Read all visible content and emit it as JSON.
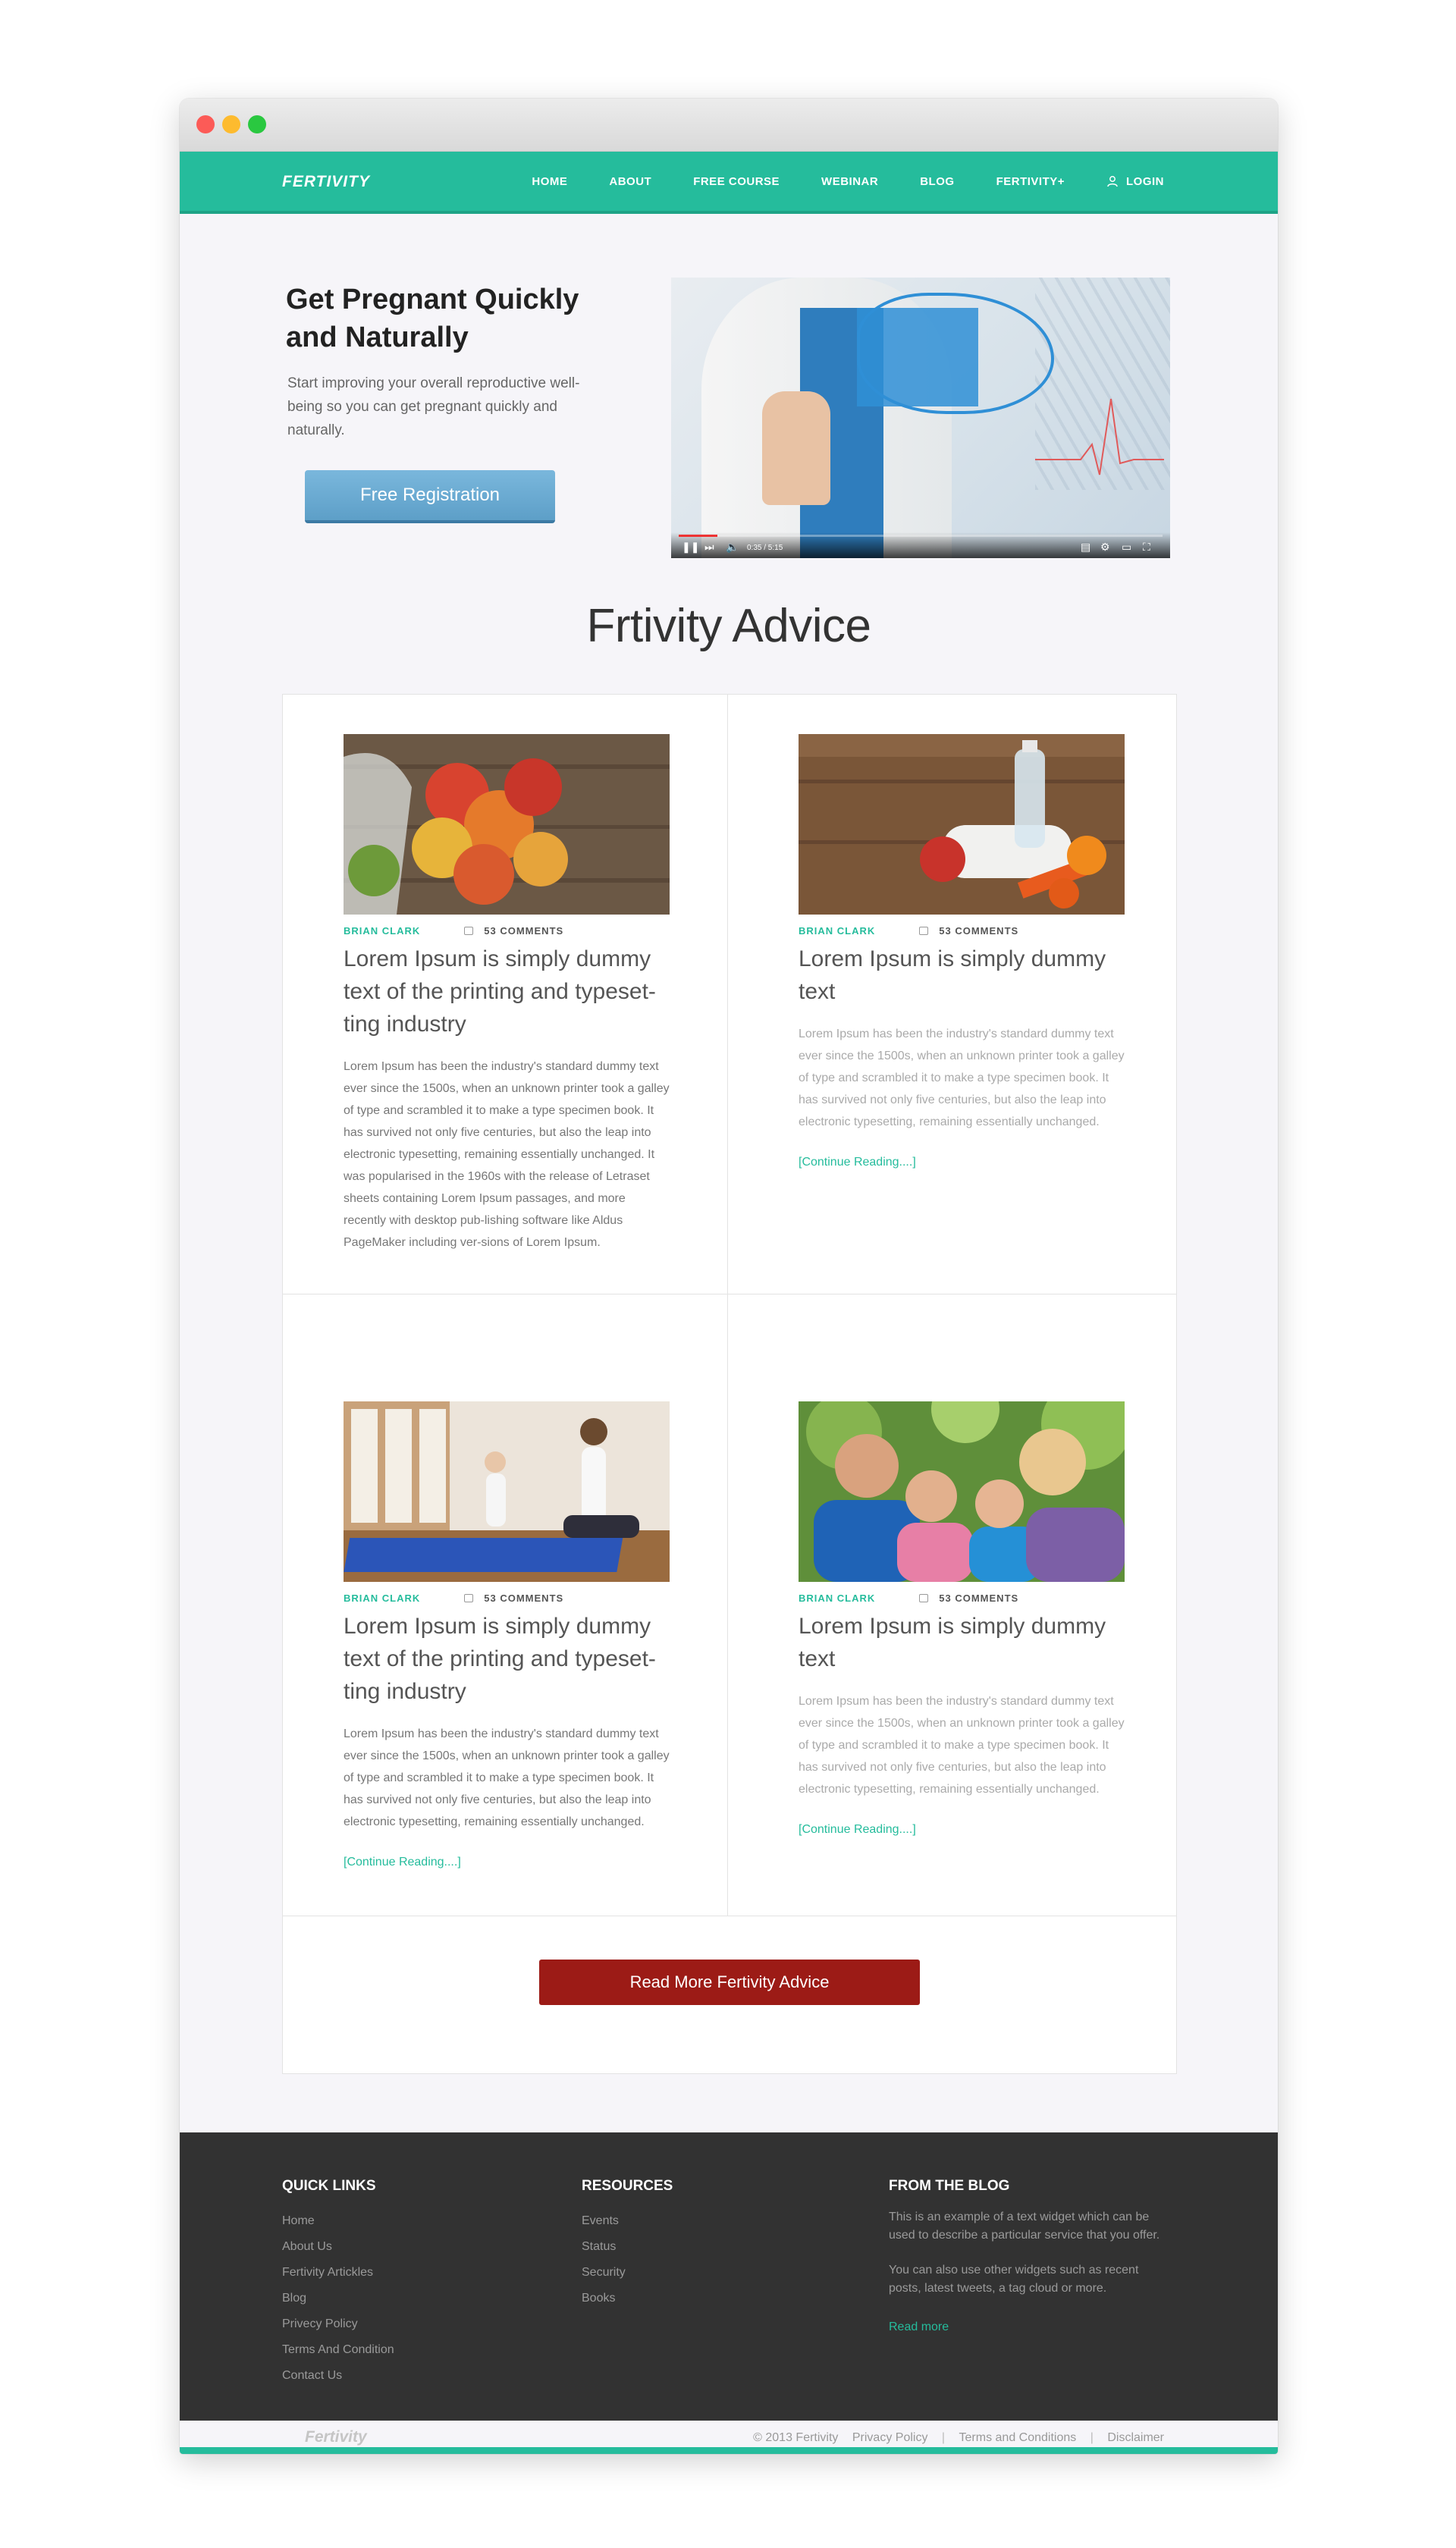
{
  "nav": {
    "brand": "FERTIVITY",
    "items": [
      "HOME",
      "ABOUT",
      "FREE COURSE",
      "WEBINAR",
      "BLOG",
      "FERTIVITY+"
    ],
    "login": "LOGIN"
  },
  "hero": {
    "title": "Get Pregnant Quickly and Naturally",
    "subtitle": "Start improving your overall reproductive well-being so you can get pregnant quickly and naturally.",
    "cta": "Free Registration",
    "video": {
      "progress": 0.08,
      "time": "0:35 / 5:15"
    }
  },
  "advice": {
    "title": "Frtivity Advice",
    "posts": [
      {
        "author": "BRIAN CLARK",
        "comments": "53 COMMENTS",
        "title": "Lorem Ipsum is simply dummy text of the printing and typeset-ting industry",
        "body": "Lorem Ipsum has been the industry's standard dummy text ever since the 1500s, when an unknown printer took a galley of type and scrambled it to make a type specimen book. It has survived not only five centuries, but also the leap into electronic typesetting, remaining essentially unchanged. It was popularised in the 1960s with the release of Letraset sheets containing Lorem Ipsum passages, and more recently with desktop pub-lishing software like Aldus PageMaker including ver-sions of Lorem Ipsum.",
        "more": ""
      },
      {
        "author": "BRIAN CLARK",
        "comments": "53 COMMENTS",
        "title": "Lorem Ipsum is simply dummy text",
        "body": "Lorem Ipsum has been the industry's standard dummy text ever since the 1500s, when an unknown printer took a galley of type and scrambled it to make a type specimen book. It has survived not only five centuries, but also the leap into electronic typesetting, remaining essentially unchanged.",
        "more": "[Continue Reading....]"
      },
      {
        "author": "BRIAN CLARK",
        "comments": "53 COMMENTS",
        "title": "Lorem Ipsum is simply dummy text of the printing and typeset-ting industry",
        "body": "Lorem Ipsum has been the industry's standard dummy text ever since the 1500s, when an unknown printer took a galley of type and scrambled it to make a type specimen book. It has survived not only five centuries, but also the leap into electronic typesetting, remaining essentially unchanged.",
        "more": "[Continue Reading....]"
      },
      {
        "author": "BRIAN CLARK",
        "comments": "53 COMMENTS",
        "title": "Lorem Ipsum is simply dummy text",
        "body": "Lorem Ipsum has been the industry's standard dummy text ever since the 1500s, when an unknown printer took a galley of type and scrambled it to make a type specimen book. It has survived not only five centuries, but also the leap into electronic typesetting, remaining essentially unchanged.",
        "more": "[Continue Reading....]"
      }
    ],
    "read_more": "Read More Fertivity Advice"
  },
  "footer": {
    "quick_links": {
      "title": "QUICK LINKS",
      "items": [
        "Home",
        "About Us",
        "Fertivity Artickles",
        "Blog",
        "Privecy Policy",
        "Terms And Condition",
        "Contact Us"
      ]
    },
    "resources": {
      "title": "RESOURCES",
      "items": [
        "Events",
        "Status",
        "Security",
        "Books"
      ]
    },
    "blog": {
      "title": "FROM THE BLOG",
      "p1": "This is an example of a text widget which can be used to describe a particular service that you offer.",
      "p2": "You can also use other widgets such as recent posts, latest tweets, a tag cloud or more.",
      "read_more": "Read more"
    }
  },
  "bottom": {
    "brand": "Fertivity",
    "copyright": "© 2013 Fertivity",
    "links": [
      "Privacy Policy",
      "Terms and Conditions",
      "Disclaimer"
    ]
  },
  "colors": {
    "accent": "#25bc9c",
    "cta_blue": "#6aa9d2",
    "cta_red": "#9c1b16",
    "footer_bg": "#323232"
  }
}
